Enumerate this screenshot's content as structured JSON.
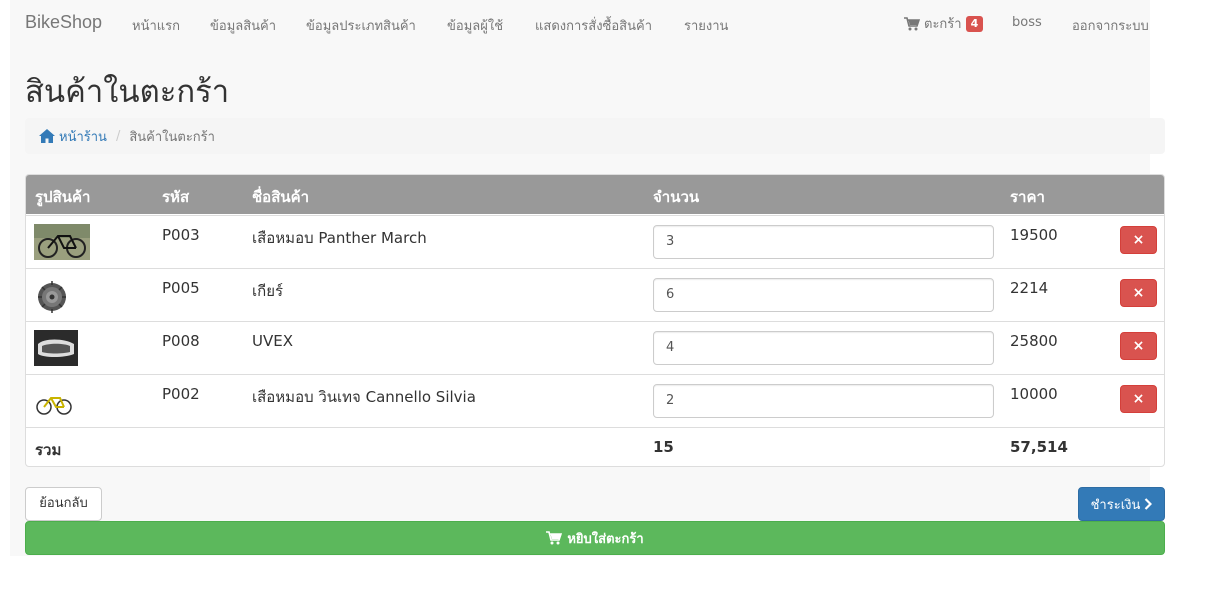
{
  "navbar": {
    "brand": "BikeShop",
    "items": [
      {
        "label": "หน้าแรก"
      },
      {
        "label": "ข้อมูลสินค้า"
      },
      {
        "label": "ข้อมูลประเภทสินค้า"
      },
      {
        "label": "ข้อมูลผู้ใช้"
      },
      {
        "label": "แสดงการสั่งซื้อสินค้า"
      },
      {
        "label": "รายงาน"
      }
    ],
    "cart_label": "ตะกร้า",
    "cart_count": "4",
    "username": "boss",
    "logout": "ออกจากระบบ"
  },
  "page": {
    "title": "สินค้าในตะกร้า"
  },
  "breadcrumb": {
    "home": "หน้าร้าน",
    "separator": "/",
    "current": "สินค้าในตะกร้า"
  },
  "table": {
    "headers": [
      "รูปสินค้า",
      "รหัส",
      "ชื่อสินค้า",
      "จำนวน",
      "ราคา"
    ],
    "rows": [
      {
        "image": "road-bike-image",
        "code": "P003",
        "name": "เสือหมอบ Panther March",
        "qty": "3",
        "price": "19500"
      },
      {
        "image": "cassette-gear-image",
        "code": "P005",
        "name": "เกียร์",
        "qty": "6",
        "price": "2214"
      },
      {
        "image": "goggles-image",
        "code": "P008",
        "name": "UVEX",
        "qty": "4",
        "price": "25800"
      },
      {
        "image": "yellow-bike-image",
        "code": "P002",
        "name": "เสือหมอบ วินเทจ Cannello Silvia",
        "qty": "2",
        "price": "10000"
      }
    ],
    "delete_label": "×",
    "total": {
      "label": "รวม",
      "qty": "15",
      "price": "57,514"
    }
  },
  "actions": {
    "back": "ย้อนกลับ",
    "pay": "ชำระเงิน",
    "continue": "หยิบใส่ตะกร้า"
  },
  "colors": {
    "header_bg": "#999999",
    "danger": "#d9534f",
    "primary": "#337ab7",
    "success": "#5cb85c"
  }
}
